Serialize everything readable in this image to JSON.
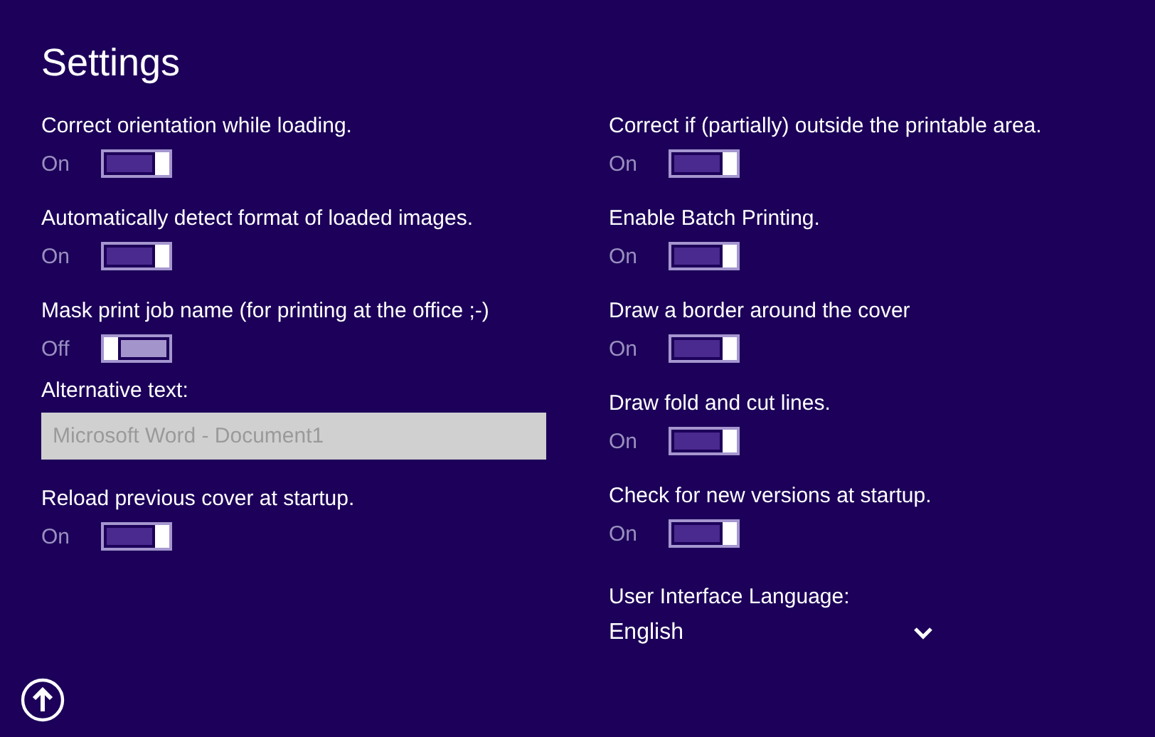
{
  "title": "Settings",
  "left_column": [
    {
      "kind": "toggle",
      "label": "Correct orientation while loading.",
      "state_text": "On",
      "on": true
    },
    {
      "kind": "toggle",
      "label": "Automatically detect format of loaded images.",
      "state_text": "On",
      "on": true
    },
    {
      "kind": "toggle",
      "label": "Mask print job name (for printing at the office ;-)",
      "state_text": "Off",
      "on": false
    },
    {
      "kind": "text_field",
      "label": "Alternative text:",
      "value": "Microsoft Word - Document1",
      "disabled": true
    },
    {
      "kind": "toggle",
      "label": "Reload previous cover at startup.",
      "state_text": "On",
      "on": true
    }
  ],
  "right_column": [
    {
      "kind": "toggle",
      "label": "Correct if (partially) outside the printable area.",
      "state_text": "On",
      "on": true
    },
    {
      "kind": "toggle",
      "label": "Enable Batch Printing.",
      "state_text": "On",
      "on": true
    },
    {
      "kind": "toggle",
      "label": "Draw a border around the cover",
      "state_text": "On",
      "on": true
    },
    {
      "kind": "toggle",
      "label": "Draw fold and cut lines.",
      "state_text": "On",
      "on": true
    },
    {
      "kind": "toggle",
      "label": "Check for new versions at startup.",
      "state_text": "On",
      "on": true
    },
    {
      "kind": "dropdown",
      "label": "User Interface Language:",
      "value": "English"
    }
  ]
}
